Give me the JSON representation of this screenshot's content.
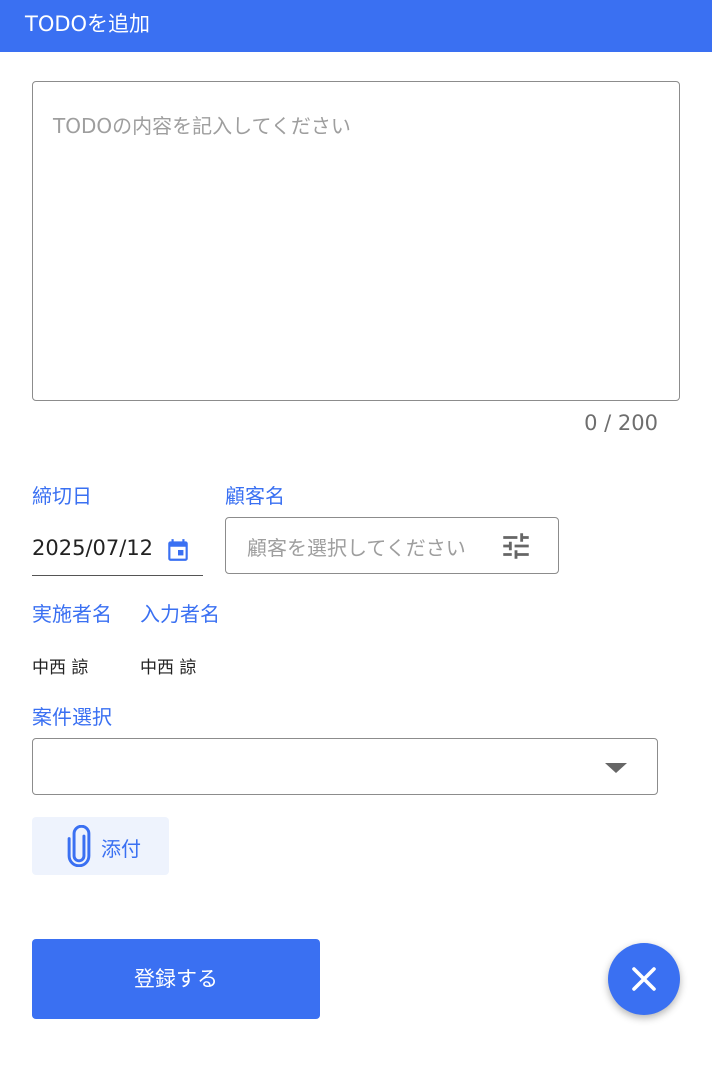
{
  "header": {
    "title": "TODOを追加"
  },
  "todo": {
    "placeholder": "TODOの内容を記入してください",
    "value": "",
    "counter": "0 / 200"
  },
  "deadline": {
    "label": "締切日",
    "value": "2025/07/12",
    "icon": "calendar-icon"
  },
  "customer": {
    "label": "顧客名",
    "placeholder": "顧客を選択してください",
    "icon": "filter-icon"
  },
  "assignee": {
    "label": "実施者名",
    "value": "中西 諒"
  },
  "entered_by": {
    "label": "入力者名",
    "value": "中西 諒"
  },
  "project": {
    "label": "案件選択",
    "value": ""
  },
  "attach": {
    "label": "添付",
    "icon": "paperclip-icon"
  },
  "submit": {
    "label": "登録する"
  },
  "fab": {
    "icon": "close-icon"
  },
  "colors": {
    "primary": "#3a70f2",
    "attach_bg": "#eef3fd"
  }
}
